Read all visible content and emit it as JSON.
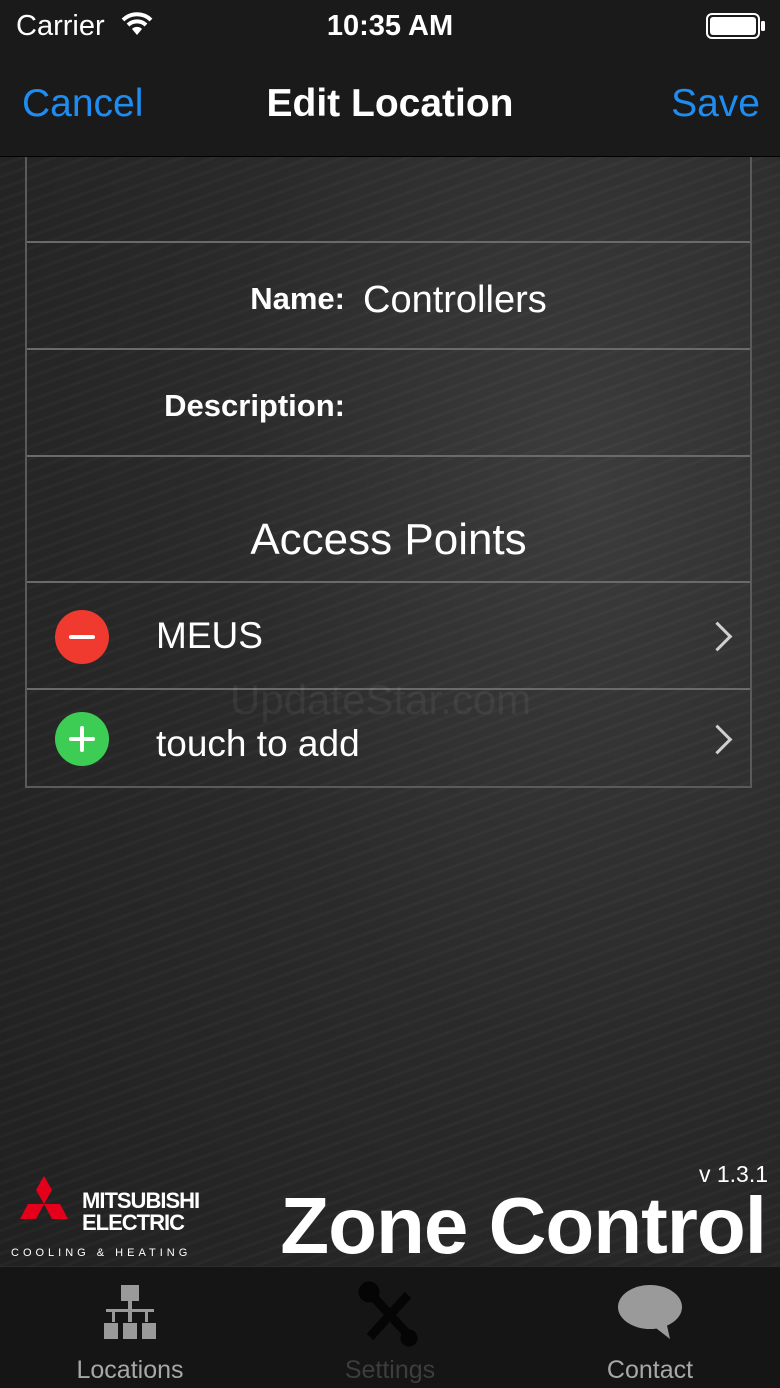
{
  "status_bar": {
    "carrier": "Carrier",
    "time": "10:35 AM"
  },
  "nav": {
    "cancel": "Cancel",
    "title": "Edit Location",
    "save": "Save"
  },
  "form": {
    "name_label": "Name:",
    "name_value": "Controllers",
    "description_label": "Description:",
    "access_points_title": "Access Points",
    "access_points": [
      {
        "name": "MEUS"
      }
    ],
    "add_prompt": "touch to add"
  },
  "watermark": "UpdateStar.com",
  "branding": {
    "logo_name": "MITSUBISHI\nELECTRIC",
    "logo_tagline": "COOLING & HEATING",
    "version": "v 1.3.1",
    "product": "Zone Control"
  },
  "tabs": [
    {
      "label": "Locations",
      "icon": "hierarchy-icon"
    },
    {
      "label": "Settings",
      "icon": "tools-icon"
    },
    {
      "label": "Contact",
      "icon": "chat-bubble-icon"
    }
  ],
  "colors": {
    "link": "#1e8cf0",
    "remove": "#f03a30",
    "add": "#3dcd55",
    "logo_red": "#e4001b"
  }
}
